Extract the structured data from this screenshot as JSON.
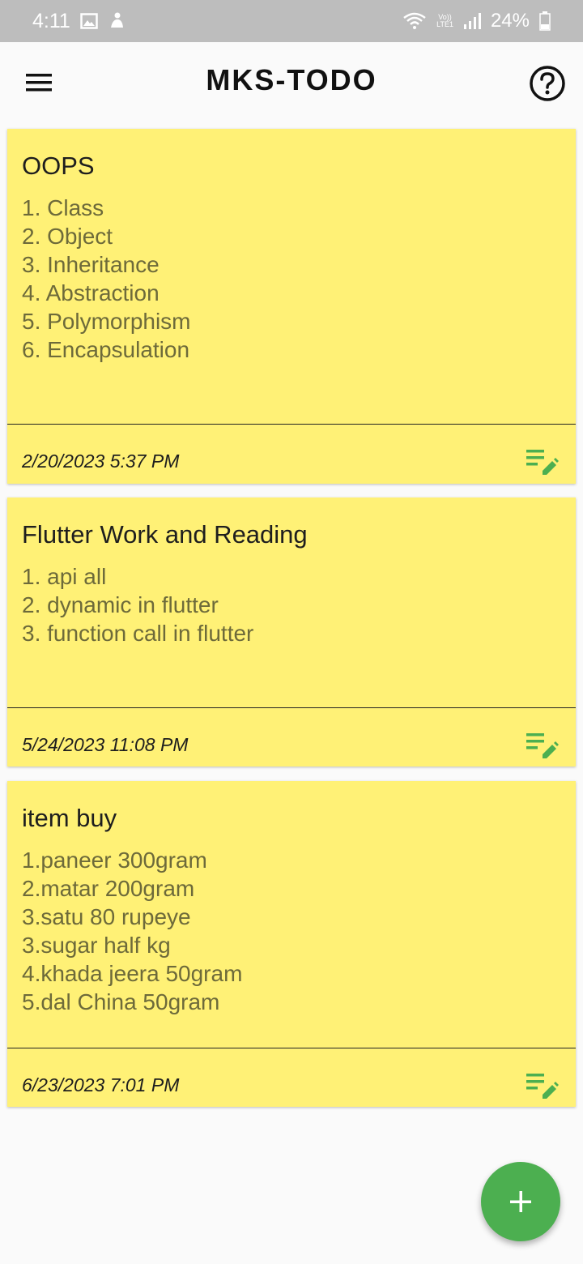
{
  "status_bar": {
    "time": "4:11",
    "lte_top": "Vo))",
    "lte_bottom": "LTE1",
    "battery": "24%",
    "icons": [
      "gallery-icon",
      "person-icon",
      "wifi-icon",
      "signal-icon",
      "battery-icon"
    ]
  },
  "app_bar": {
    "title": "MKS-TODO",
    "icons": [
      "menu-icon",
      "help-icon"
    ]
  },
  "notes": [
    {
      "title": "OOPS",
      "body": "1. Class\n2. Object\n3. Inheritance\n4. Abstraction\n5. Polymorphism\n6. Encapsulation",
      "date": "2/20/2023 5:37 PM"
    },
    {
      "title": "Flutter Work and Reading",
      "body": "1. api all\n2. dynamic in flutter\n3. function call in flutter",
      "date": "5/24/2023 11:08 PM"
    },
    {
      "title": "item buy",
      "body": "1.paneer 300gram\n2.matar 200gram\n3.satu 80 rupeye\n3.sugar half kg\n4.khada jeera 50gram\n5.dal China 50gram",
      "date": "6/23/2023 7:01 PM"
    }
  ],
  "colors": {
    "card": "#fff176",
    "accent": "#4caf50",
    "status_bar": "#bdbdbd"
  }
}
